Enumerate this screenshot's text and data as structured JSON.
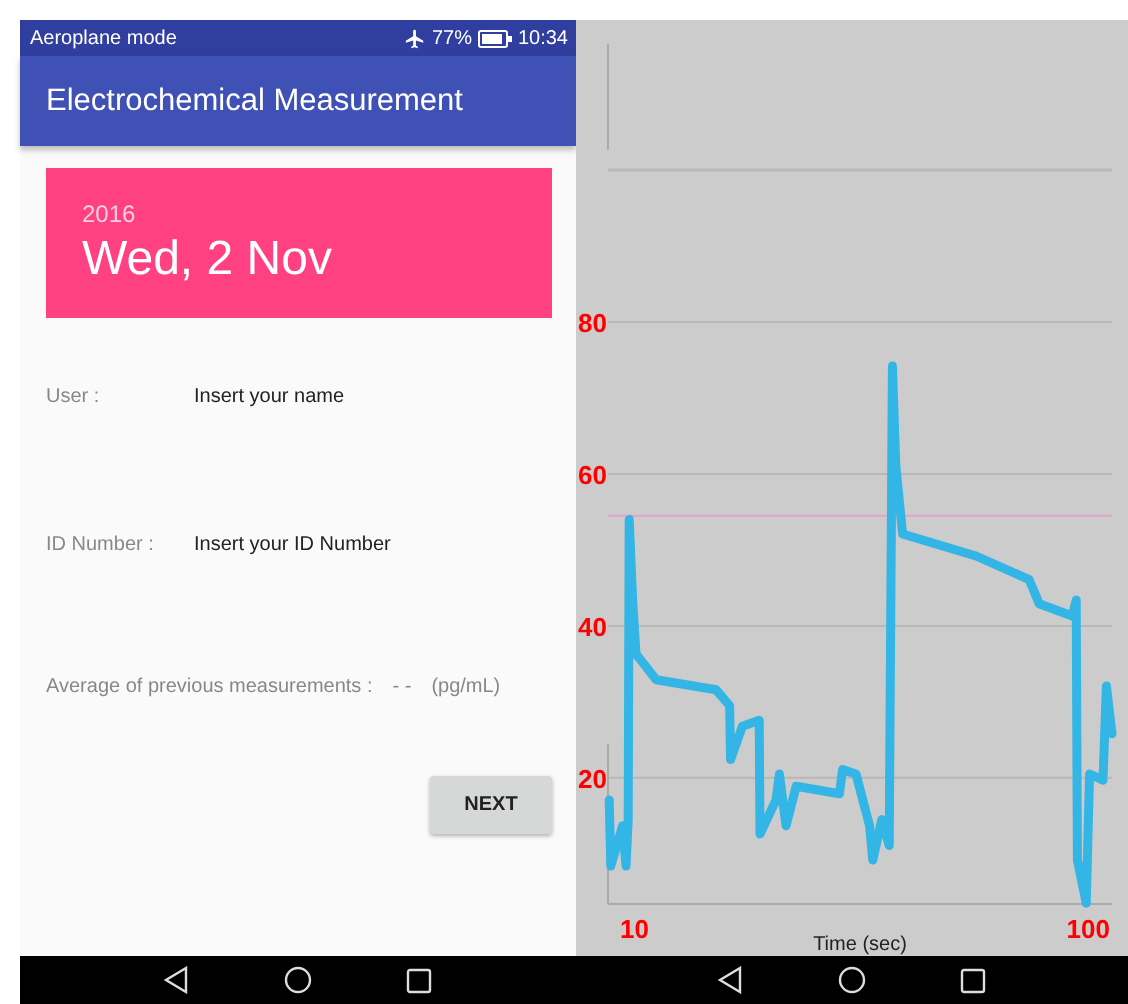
{
  "left_screen": {
    "status_bar": {
      "mode": "Aeroplane mode",
      "battery": "77%",
      "time": "10:34"
    },
    "app_bar": {
      "title": "Electrochemical Measurement"
    },
    "date_card": {
      "year": "2016",
      "date": "Wed, 2 Nov"
    },
    "fields": [
      {
        "label": "User :",
        "placeholder": "Insert your name"
      },
      {
        "label": "ID Number :",
        "placeholder": "Insert your ID Number"
      }
    ],
    "average": {
      "label": "Average of previous measurements :",
      "value": "- -",
      "unit": "(pg/mL)"
    },
    "buttons": [
      "NEXT"
    ]
  },
  "right_screen": {
    "chart_data": {
      "type": "line",
      "xlabel": "Time (sec)",
      "xlim": [
        4.75,
        104.7
      ],
      "ylim": [
        3.4,
        100
      ],
      "xticks": [
        10,
        100
      ],
      "yticks": [
        20,
        40,
        60,
        80
      ],
      "grid": true,
      "ref_lines": [
        {
          "axis": "y",
          "value": 54.5,
          "color": "#e8a0c8"
        }
      ],
      "x": [
        4.97,
        5.31,
        7.64,
        8.3,
        8.75,
        8.97,
        9.64,
        10.3,
        14.3,
        26.18,
        28.85,
        29.07,
        31.4,
        34.74,
        34.9,
        38.07,
        38.73,
        40.06,
        42.07,
        50.62,
        51.28,
        53.95,
        56.61,
        57.28,
        59.06,
        60.5,
        61.17,
        61.83,
        63.17,
        77.71,
        88.27,
        90.27,
        96.82,
        97.59,
        97.82,
        99.59,
        100.26,
        102.92,
        103.59,
        104.7
      ],
      "series": [
        {
          "color": "#33b5e5",
          "values": [
            17.1,
            8.4,
            13.7,
            8.4,
            14.5,
            54,
            43.4,
            36.3,
            32.9,
            31.6,
            29.5,
            22.4,
            26.8,
            27.6,
            12.6,
            17.1,
            20.5,
            13.7,
            18.9,
            17.9,
            21.1,
            20.5,
            13.7,
            9.2,
            14.5,
            11.1,
            74.2,
            61.1,
            52.1,
            49.2,
            46.1,
            42.9,
            41.3,
            43.4,
            9.2,
            3.5,
            20.5,
            19.7,
            32.1,
            25.8
          ]
        }
      ]
    }
  }
}
